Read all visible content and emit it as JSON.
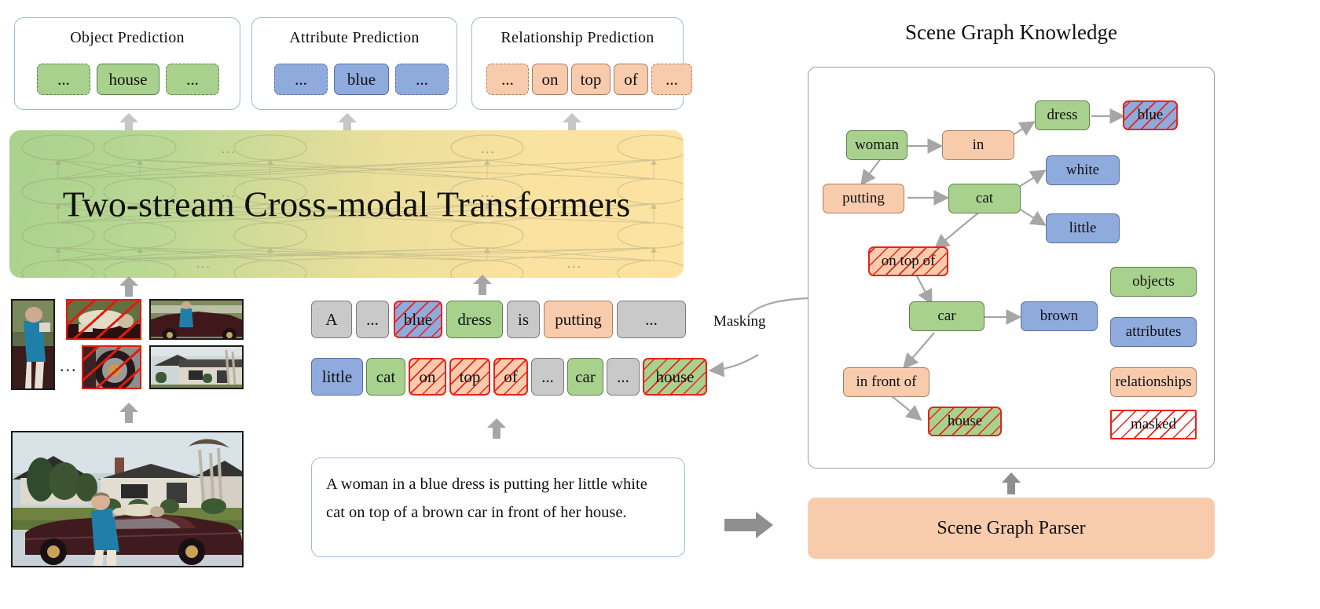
{
  "prediction_heads": [
    {
      "name": "object-prediction",
      "title": "Object Prediction",
      "tokens": [
        {
          "text": "...",
          "kind": "obj",
          "dashed": true
        },
        {
          "text": "house",
          "kind": "obj",
          "dashed": false
        },
        {
          "text": "...",
          "kind": "obj",
          "dashed": true
        }
      ]
    },
    {
      "name": "attribute-prediction",
      "title": "Attribute Prediction",
      "tokens": [
        {
          "text": "...",
          "kind": "attr",
          "dashed": true
        },
        {
          "text": "blue",
          "kind": "attr",
          "dashed": false
        },
        {
          "text": "...",
          "kind": "attr",
          "dashed": true
        }
      ]
    },
    {
      "name": "relationship-prediction",
      "title": "Relationship Prediction",
      "tokens": [
        {
          "text": "...",
          "kind": "rel",
          "dashed": true
        },
        {
          "text": "on",
          "kind": "rel",
          "dashed": false
        },
        {
          "text": "top",
          "kind": "rel",
          "dashed": false
        },
        {
          "text": "of",
          "kind": "rel",
          "dashed": false
        },
        {
          "text": "...",
          "kind": "rel",
          "dashed": true
        }
      ]
    }
  ],
  "transformer": {
    "label": "Two-stream Cross-modal Transformers",
    "ellipsis": "..."
  },
  "token_rows": [
    {
      "name": "token-row-1",
      "tokens": [
        {
          "text": "A",
          "kind": "none",
          "masked": false
        },
        {
          "text": "...",
          "kind": "none",
          "masked": false
        },
        {
          "text": "blue",
          "kind": "attr",
          "masked": true
        },
        {
          "text": "dress",
          "kind": "obj",
          "masked": false
        },
        {
          "text": "is",
          "kind": "none",
          "masked": false
        },
        {
          "text": "putting",
          "kind": "rel",
          "masked": false
        },
        {
          "text": "...",
          "kind": "none",
          "masked": false
        }
      ]
    },
    {
      "name": "token-row-2",
      "tokens": [
        {
          "text": "little",
          "kind": "attr",
          "masked": false
        },
        {
          "text": "cat",
          "kind": "obj",
          "masked": false
        },
        {
          "text": "on",
          "kind": "rel",
          "masked": true
        },
        {
          "text": "top",
          "kind": "rel",
          "masked": true
        },
        {
          "text": "of",
          "kind": "rel",
          "masked": true
        },
        {
          "text": "...",
          "kind": "none",
          "masked": false
        },
        {
          "text": "car",
          "kind": "obj",
          "masked": false
        },
        {
          "text": "...",
          "kind": "none",
          "masked": false
        },
        {
          "text": "house",
          "kind": "obj",
          "masked": true
        }
      ]
    }
  ],
  "masking_label": "Masking",
  "caption": {
    "line1": "A woman in a blue dress is putting her little white",
    "line2": "cat on top of a brown car in front of her house."
  },
  "scene_graph": {
    "title": "Scene Graph Knowledge",
    "nodes": [
      {
        "id": "woman",
        "label": "woman",
        "kind": "obj",
        "masked": false
      },
      {
        "id": "in",
        "label": "in",
        "kind": "rel",
        "masked": false
      },
      {
        "id": "dress",
        "label": "dress",
        "kind": "obj",
        "masked": false
      },
      {
        "id": "blue",
        "label": "blue",
        "kind": "attr",
        "masked": true
      },
      {
        "id": "putting",
        "label": "putting",
        "kind": "rel",
        "masked": false
      },
      {
        "id": "cat",
        "label": "cat",
        "kind": "obj",
        "masked": false
      },
      {
        "id": "white",
        "label": "white",
        "kind": "attr",
        "masked": false
      },
      {
        "id": "little",
        "label": "little",
        "kind": "attr",
        "masked": false
      },
      {
        "id": "on_top_of",
        "label": "on top of",
        "kind": "rel",
        "masked": true
      },
      {
        "id": "car",
        "label": "car",
        "kind": "obj",
        "masked": false
      },
      {
        "id": "brown",
        "label": "brown",
        "kind": "attr",
        "masked": false
      },
      {
        "id": "in_front_of",
        "label": "in front of",
        "kind": "rel",
        "masked": false
      },
      {
        "id": "house",
        "label": "house",
        "kind": "obj",
        "masked": true
      }
    ],
    "edges": [
      [
        "woman",
        "in"
      ],
      [
        "in",
        "dress"
      ],
      [
        "dress",
        "blue"
      ],
      [
        "woman",
        "putting"
      ],
      [
        "putting",
        "cat"
      ],
      [
        "cat",
        "white"
      ],
      [
        "cat",
        "little"
      ],
      [
        "cat",
        "on_top_of"
      ],
      [
        "on_top_of",
        "car"
      ],
      [
        "car",
        "brown"
      ],
      [
        "car",
        "in_front_of"
      ],
      [
        "in_front_of",
        "house"
      ]
    ],
    "legend": [
      {
        "label": "objects",
        "kind": "obj",
        "masked": false
      },
      {
        "label": "attributes",
        "kind": "attr",
        "masked": false
      },
      {
        "label": "relationships",
        "kind": "rel",
        "masked": false
      },
      {
        "label": "masked",
        "kind": "plain",
        "masked": true
      }
    ]
  },
  "parser": {
    "label": "Scene Graph Parser"
  },
  "image_region": {
    "ellipsis": "..."
  },
  "colors": {
    "object_green": "#a9d18e",
    "attribute_blue": "#8faadc",
    "relationship_orange": "#f8cbad",
    "neutral_gray": "#c9c9c9",
    "mask_red": "#e8231a",
    "card_border_blue": "#9dbbe0",
    "arrow_gray": "#a6a6a6"
  }
}
